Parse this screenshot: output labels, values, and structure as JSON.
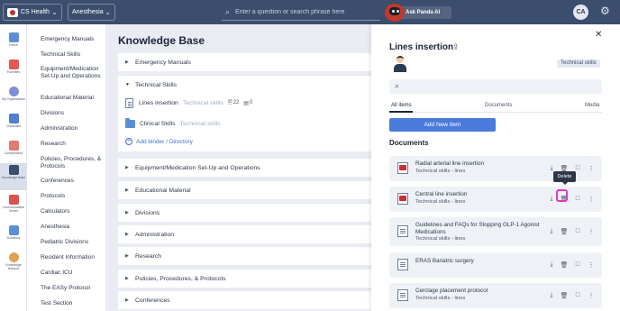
{
  "topbar": {
    "org": "CS Health",
    "department": "Anesthesia",
    "search_placeholder": "Enter a question or search phrase here",
    "panda_label": "Ask Panda AI",
    "avatar_initials": "CA"
  },
  "rail": [
    {
      "label": "Home"
    },
    {
      "label": "Favorites"
    },
    {
      "label": "My Organization"
    },
    {
      "label": "Checklists"
    },
    {
      "label": "Compendium"
    },
    {
      "label": "Knowledge Base"
    },
    {
      "label": "Communication Center"
    },
    {
      "label": "Solutions"
    },
    {
      "label": "Knowledge Network"
    }
  ],
  "categories": [
    "Emergency Manuals",
    "Technical Skills",
    "Equipment/Medication Set-Up and Operations",
    "Educational Material",
    "Divisions",
    "Administration",
    "Research",
    "Policies, Procedures, & Protocols",
    "Conferences",
    "Protocols",
    "Calculators",
    "Anesthesia",
    "Pediatric Divisions",
    "Resident Information",
    "Cardiac ICU",
    "The EASy Protocol",
    "Test Section"
  ],
  "main": {
    "title": "Knowledge Base",
    "sections": [
      "Emergency Manuals",
      "Technical Skills",
      "Equipment/Medication Set-Up and Operations",
      "Educational Material",
      "Divisions",
      "Administration",
      "Research",
      "Policies, Procedures, & Protocols",
      "Conferences"
    ],
    "binders": [
      {
        "name": "Lines insertion",
        "sub": "Technical skills",
        "doc_count": "22",
        "other_count": "0"
      },
      {
        "name": "Clinical Skills",
        "sub": "Technical skills"
      }
    ],
    "add_binder": "Add binder / Directory"
  },
  "panel": {
    "title": "Lines insertion",
    "tag": "Technical skills",
    "filters": [
      "All items",
      "Documents",
      "Media"
    ],
    "add_new": "Add New Item",
    "documents_heading": "Documents",
    "tooltip": "Delete",
    "documents": [
      {
        "title": "Radial arterial line insertion",
        "sub": "Technical skills - lines",
        "thumb": "red"
      },
      {
        "title": "Central line insertion",
        "sub": "Technical skills - lines",
        "thumb": "red"
      },
      {
        "title": "Guidelines and FAQs for Stopping GLP-1 Agonist Medications",
        "sub": "Technical skills - lines",
        "thumb": "plain"
      },
      {
        "title": "ERAS Bariatric surgery",
        "sub": "",
        "thumb": "plain"
      },
      {
        "title": "Cerclage placement protocol",
        "sub": "Technical skills - lines",
        "thumb": "plain"
      }
    ]
  },
  "colors": {
    "topbar": "#3b4e6e",
    "accent": "#4a7bdc",
    "highlight": "#e535c9"
  }
}
